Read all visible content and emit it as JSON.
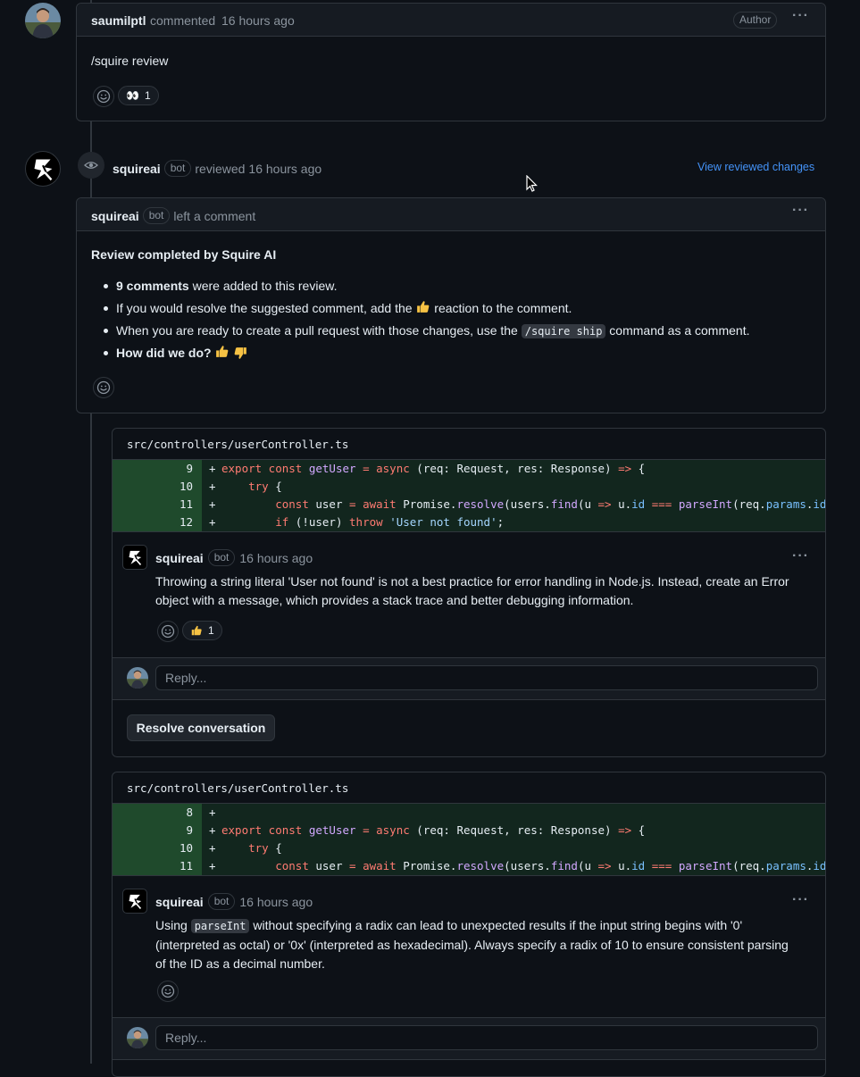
{
  "comment1": {
    "author": "saumilptl",
    "action": "commented",
    "time": "16 hours ago",
    "role_badge": "Author",
    "body": "/squire review",
    "reaction_eyes_count": "1"
  },
  "review_event": {
    "author": "squireai",
    "bot_badge": "bot",
    "action": "reviewed",
    "time": "16 hours ago",
    "view_changes_label": "View reviewed changes"
  },
  "review_comment": {
    "author": "squireai",
    "bot_badge": "bot",
    "action": "left a comment",
    "title": "Review completed by Squire AI",
    "item1_bold": "9 comments",
    "item1_rest": " were added to this review.",
    "item2_pre": "If you would resolve the suggested comment, add the ",
    "item2_post": " reaction to the comment.",
    "item3_pre": "When you are ready to create a pull request with those changes, use the ",
    "item3_code": "/squire ship",
    "item3_post": " command as a comment.",
    "item4_bold": "How did we do?"
  },
  "thread1": {
    "file_path": "src/controllers/userController.ts",
    "diff_lines": [
      {
        "num": "9",
        "sign": "+",
        "code": "export const getUser = async (req: Request, res: Response) => {"
      },
      {
        "num": "10",
        "sign": "+",
        "code": "    try {"
      },
      {
        "num": "11",
        "sign": "+",
        "code": "        const user = await Promise.resolve(users.find(u => u.id === parseInt(req.params.id)));"
      },
      {
        "num": "12",
        "sign": "+",
        "code": "        if (!user) throw 'User not found';"
      }
    ],
    "author": "squireai",
    "bot_badge": "bot",
    "time": "16 hours ago",
    "body": "Throwing a string literal 'User not found' is not a best practice for error handling in Node.js. Instead, create an Error object with a message, which provides a stack trace and better debugging information.",
    "thumbs_count": "1",
    "reply_placeholder": "Reply...",
    "resolve_label": "Resolve conversation"
  },
  "thread2": {
    "file_path": "src/controllers/userController.ts",
    "diff_lines": [
      {
        "num": "8",
        "sign": "+",
        "code": ""
      },
      {
        "num": "9",
        "sign": "+",
        "code": "export const getUser = async (req: Request, res: Response) => {"
      },
      {
        "num": "10",
        "sign": "+",
        "code": "    try {"
      },
      {
        "num": "11",
        "sign": "+",
        "code": "        const user = await Promise.resolve(users.find(u => u.id === parseInt(req.params.id)));"
      }
    ],
    "author": "squireai",
    "bot_badge": "bot",
    "time": "16 hours ago",
    "body_pre": "Using ",
    "body_code": "parseInt",
    "body_post": " without specifying a radix can lead to unexpected results if the input string begins with '0' (interpreted as octal) or '0x' (interpreted as hexadecimal). Always specify a radix of 10 to ensure consistent parsing of the ID as a decimal number.",
    "reply_placeholder": "Reply..."
  },
  "colors": {
    "background": "#0d1117",
    "border": "#30363d",
    "link": "#4493f8",
    "diff_added": "#12261e",
    "diff_added_num": "#1f4a2c"
  }
}
